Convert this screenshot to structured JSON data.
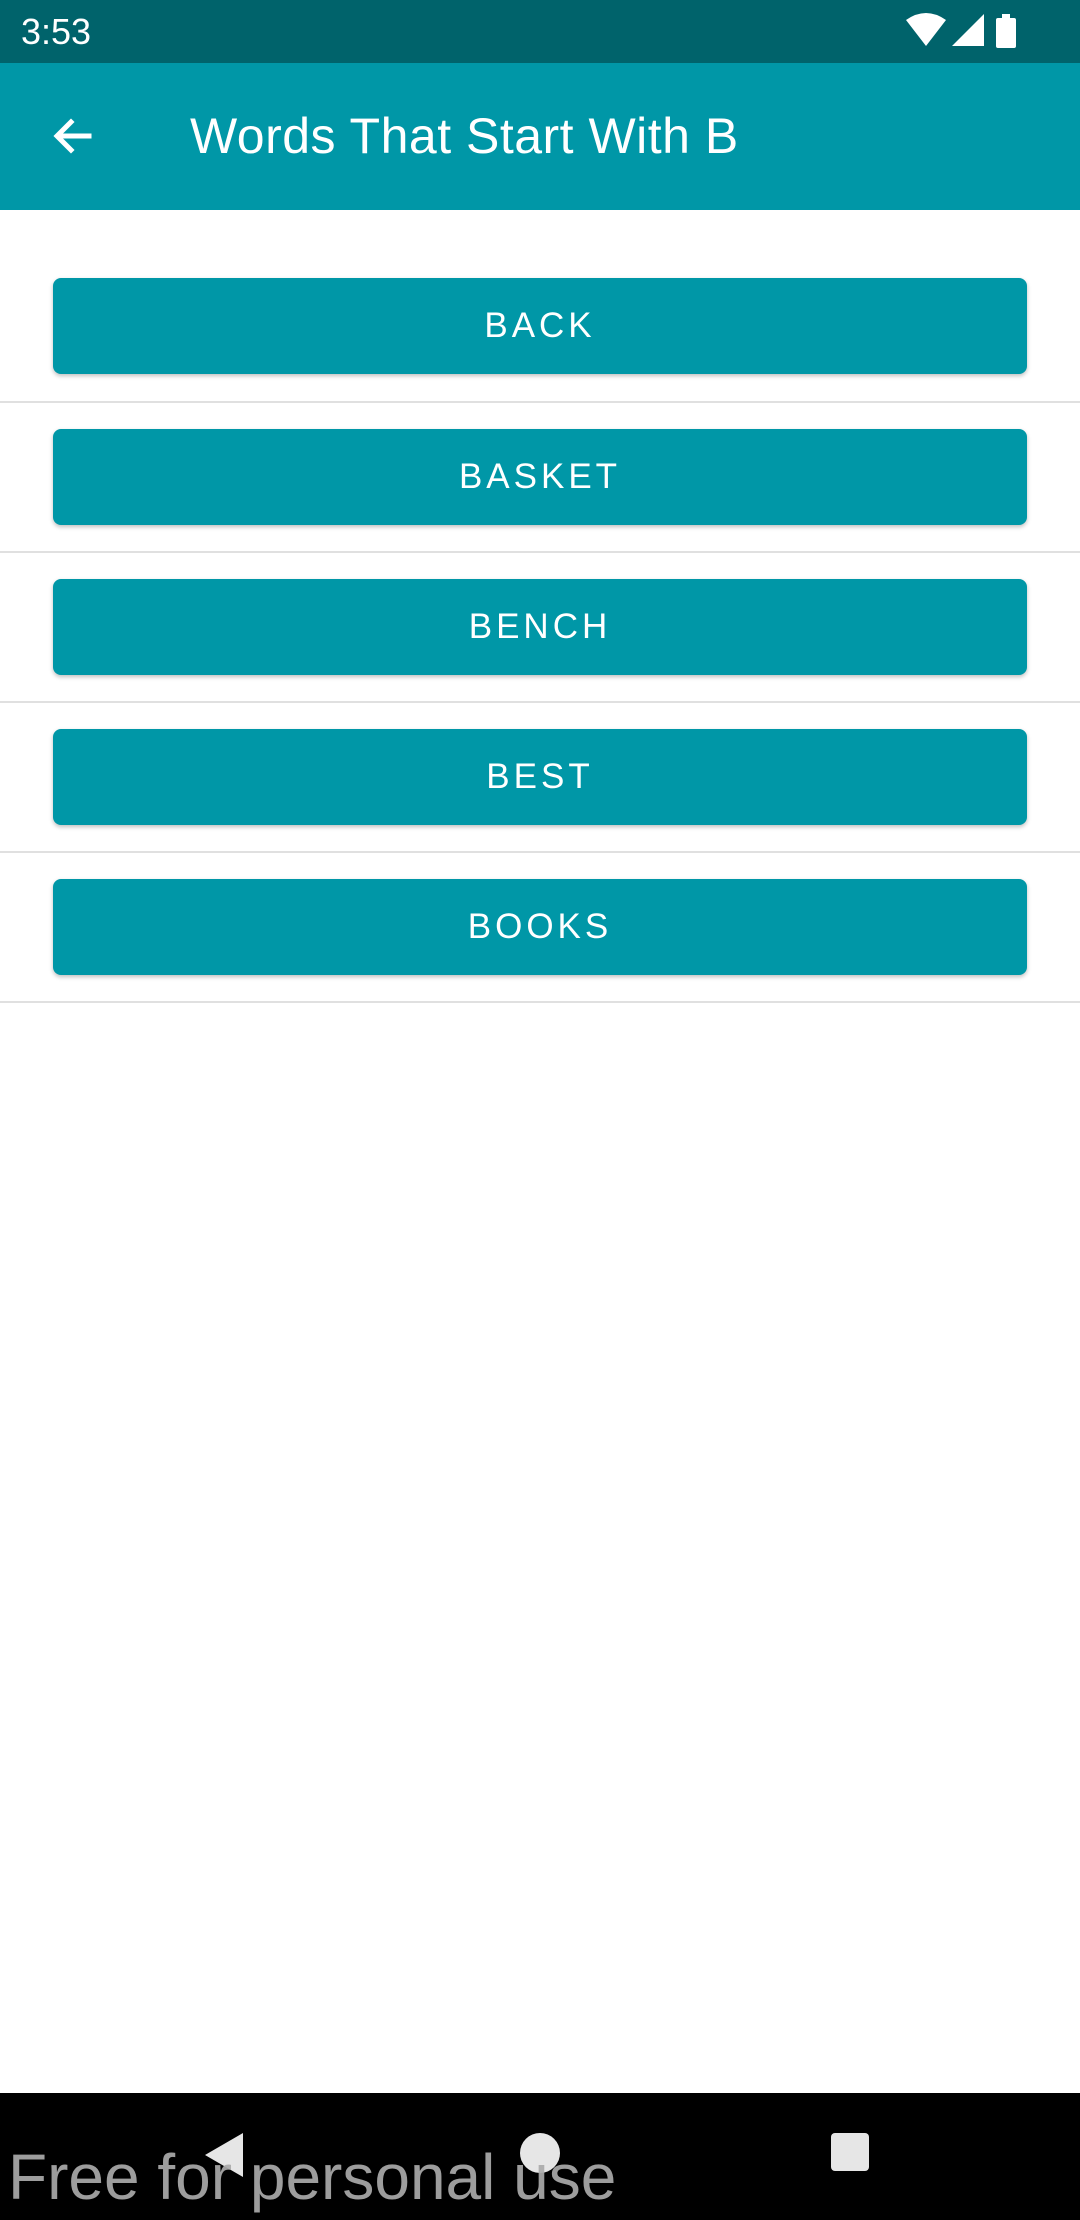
{
  "status_bar": {
    "time": "3:53",
    "icons": [
      "wifi-icon",
      "cell-signal-icon",
      "battery-icon"
    ]
  },
  "app_bar": {
    "title": "Words That Start With B",
    "back_icon": "arrow-back-icon"
  },
  "words": [
    {
      "label": "BACK"
    },
    {
      "label": "BASKET"
    },
    {
      "label": "BENCH"
    },
    {
      "label": "BEST"
    },
    {
      "label": "BOOKS"
    }
  ],
  "nav_bar": {
    "icons": [
      "nav-back-icon",
      "nav-home-icon",
      "nav-recents-icon"
    ]
  },
  "watermark": "Free for personal use",
  "colors": {
    "primary": "#0097a7",
    "primary_dark": "#00636b",
    "divider": "#e0e0e0"
  }
}
